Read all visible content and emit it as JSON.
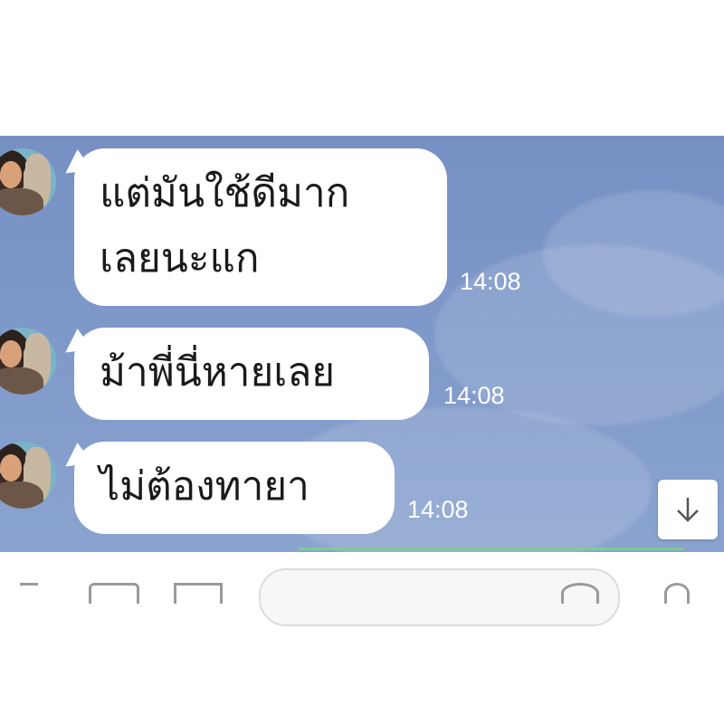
{
  "messages": [
    {
      "text_line1": "แต่มันใช้ดีมาก",
      "text_line2": "เลยนะแก",
      "time": "14:08"
    },
    {
      "text_line1": "ม้าพี่นี่หายเลย",
      "time": "14:08"
    },
    {
      "text_line1": "ไม่ต้องทายา",
      "time": "14:08"
    }
  ],
  "icons": {
    "scroll_down": "arrow-down-icon",
    "avatar": "avatar"
  },
  "colors": {
    "chat_background": "#7690c4",
    "bubble": "#ffffff",
    "timestamp": "#ffffff",
    "accent_line": "#7ccf8a"
  }
}
